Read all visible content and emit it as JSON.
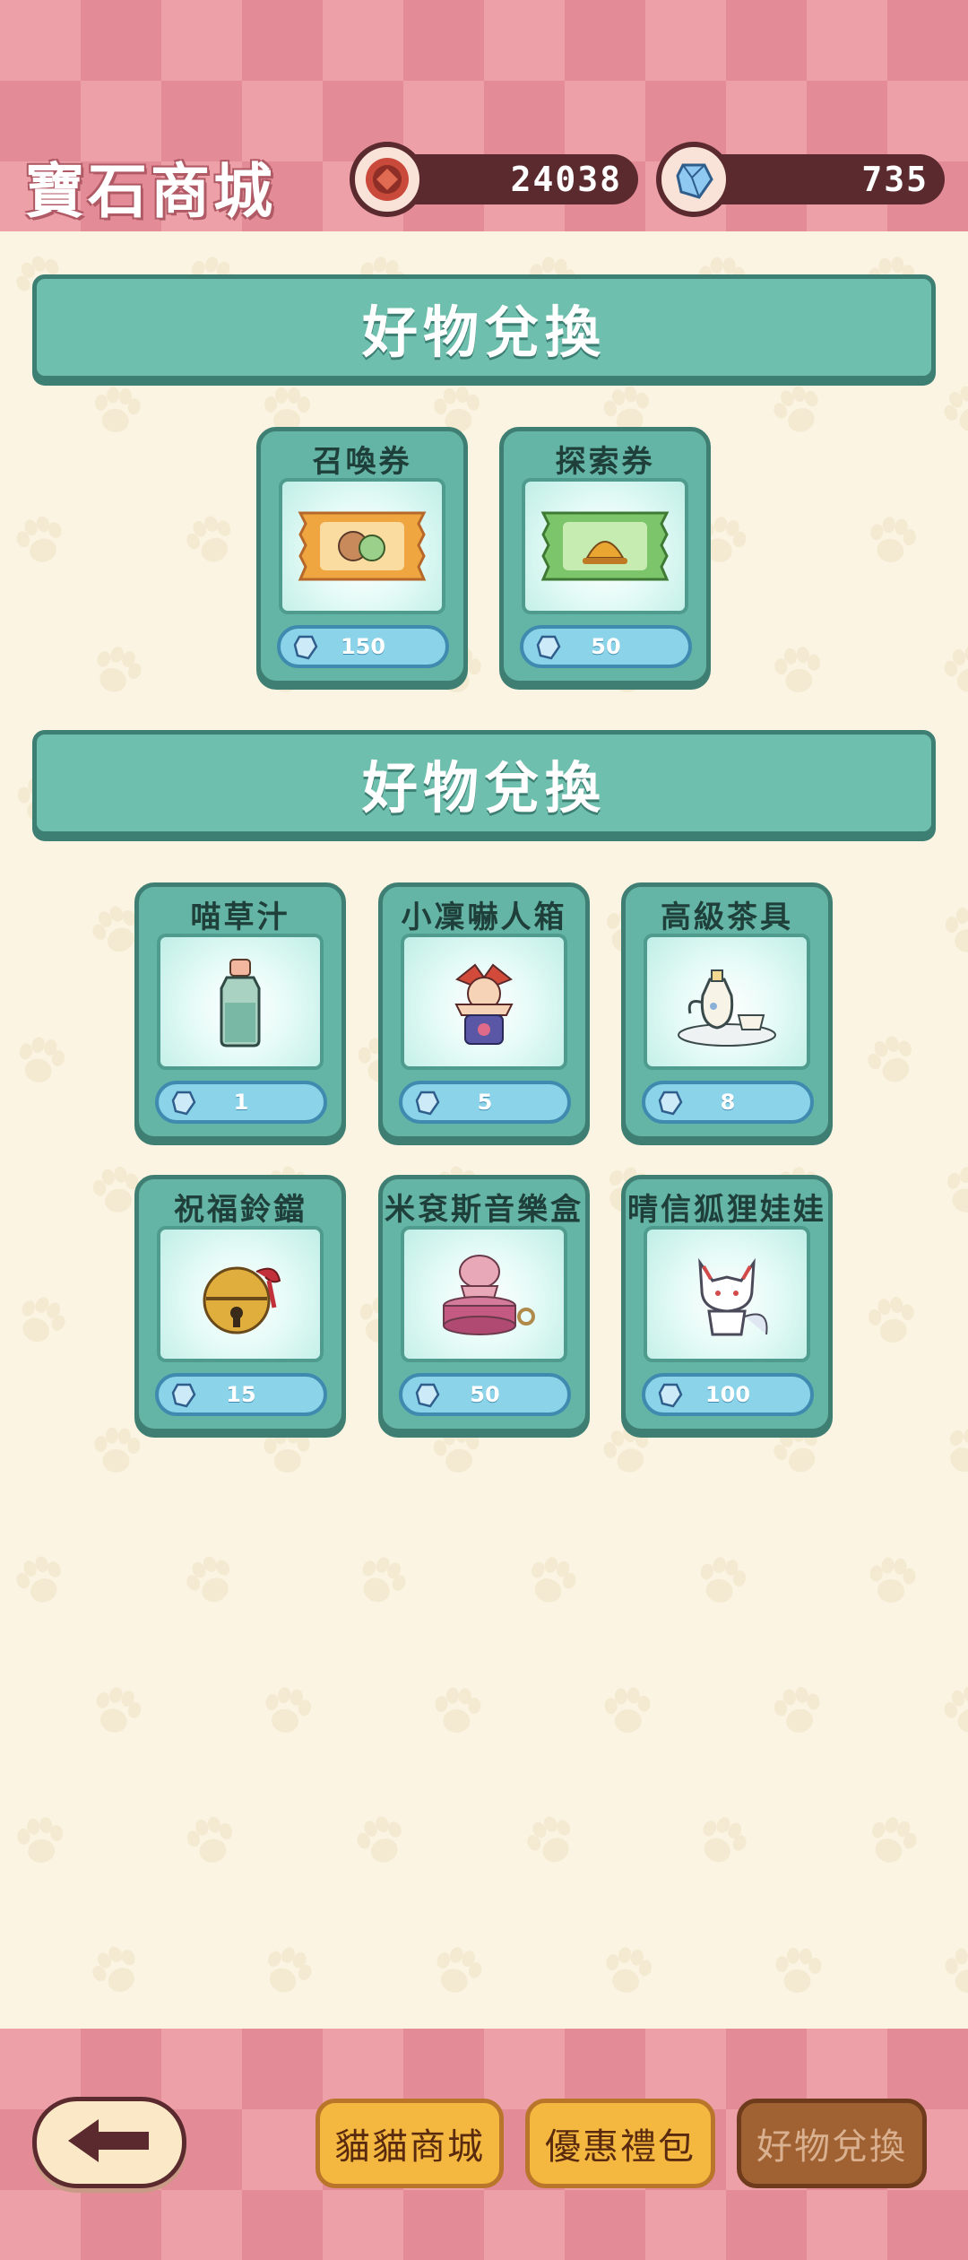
{
  "header": {
    "title": "寶石商城",
    "coins": "24038",
    "gems": "735"
  },
  "sections": [
    {
      "title": "好物兌換",
      "items": [
        {
          "name": "召喚券",
          "price": "150",
          "icon": "summon-ticket-icon"
        },
        {
          "name": "探索券",
          "price": "50",
          "icon": "explore-ticket-icon"
        }
      ]
    },
    {
      "title": "好物兌換",
      "items": [
        {
          "name": "喵草汁",
          "price": "1",
          "icon": "catnip-juice-bottle-icon"
        },
        {
          "name": "小凜嚇人箱",
          "price": "5",
          "icon": "jack-in-the-box-icon"
        },
        {
          "name": "高級茶具",
          "price": "8",
          "icon": "tea-set-icon"
        },
        {
          "name": "祝福鈴鐺",
          "price": "15",
          "icon": "blessing-bell-icon"
        },
        {
          "name": "米袞斯音樂盒",
          "price": "50",
          "icon": "music-box-icon"
        },
        {
          "name": "晴信狐狸娃娃",
          "price": "100",
          "icon": "fox-doll-icon"
        }
      ]
    }
  ],
  "footer": {
    "back": "back-arrow-icon",
    "tabs": [
      {
        "label": "貓貓商城"
      },
      {
        "label": "優惠禮包"
      },
      {
        "label": "好物兌換",
        "active": true
      }
    ]
  },
  "colors": {
    "accent": "#6ebfae",
    "header": "#eea0a8",
    "price_bg": "#8bd3e8"
  }
}
